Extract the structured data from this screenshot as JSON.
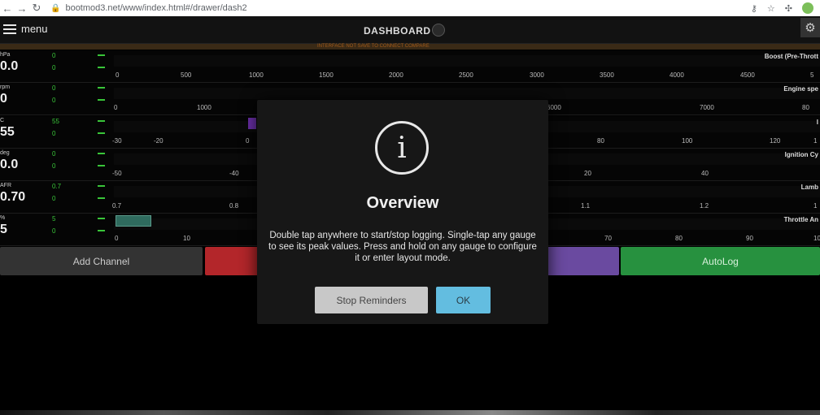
{
  "browser": {
    "url": "bootmod3.net/www/index.html#/drawer/dash2",
    "back_icon": "←",
    "forward_icon": "→",
    "reload_icon": "↻",
    "lock_icon": "🔒",
    "key_icon": "⚷",
    "star_icon": "☆",
    "puzzle_icon": "✣"
  },
  "header": {
    "menu_label": "menu",
    "title": "DASHBOARD",
    "gear_icon": "⚙",
    "notice": "INTERFACE NOT SAVE TO CONNECT COMPARE"
  },
  "gauges": [
    {
      "unit": "hPa",
      "value": "0.0",
      "max": "0",
      "min": "0",
      "name": "Boost (Pre-Thrott",
      "ticks": [
        "0",
        "500",
        "1000",
        "1500",
        "2000",
        "2500",
        "3000",
        "3500",
        "4000",
        "4500",
        "5"
      ]
    },
    {
      "unit": "rpm",
      "value": "0",
      "max": "0",
      "min": "0",
      "name": "Engine spe",
      "ticks": [
        "0",
        "1000",
        "6000",
        "7000",
        "80"
      ]
    },
    {
      "unit": "C",
      "value": "55",
      "max": "55",
      "min": "0",
      "name": "I",
      "ticks": [
        "-30",
        "-20",
        "0",
        "80",
        "100",
        "120",
        "1"
      ]
    },
    {
      "unit": "deg",
      "value": "0.0",
      "max": "0",
      "min": "0",
      "name": "Ignition Cy",
      "ticks": [
        "-50",
        "-40",
        "20",
        "40"
      ]
    },
    {
      "unit": "AFR",
      "value": "0.70",
      "max": "0.7",
      "min": "0",
      "name": "Lamb",
      "ticks": [
        "0.7",
        "0.8",
        "1.1",
        "1.2",
        "1"
      ]
    },
    {
      "unit": "%",
      "value": "5",
      "max": "5",
      "min": "0",
      "name": "Throttle An",
      "ticks": [
        "0",
        "10",
        "70",
        "80",
        "90",
        "10"
      ]
    }
  ],
  "buttons": {
    "add_channel": "Add Channel",
    "autolog": "AutoLog"
  },
  "modal": {
    "icon": "i",
    "title": "Overview",
    "message": "Double tap anywhere to start/stop logging. Single-tap any gauge to see its peak values. Press and hold on any gauge to configure it or enter layout mode.",
    "stop_label": "Stop Reminders",
    "ok_label": "OK"
  },
  "colors": {
    "accent_green": "#39c539",
    "autolog_green": "#27913f",
    "red": "#b3262a",
    "purple": "#6a4aa0",
    "ok_blue": "#63bde0",
    "throttle_bar": "#2f6b5e",
    "iat_bar": "#6a2fa8"
  }
}
